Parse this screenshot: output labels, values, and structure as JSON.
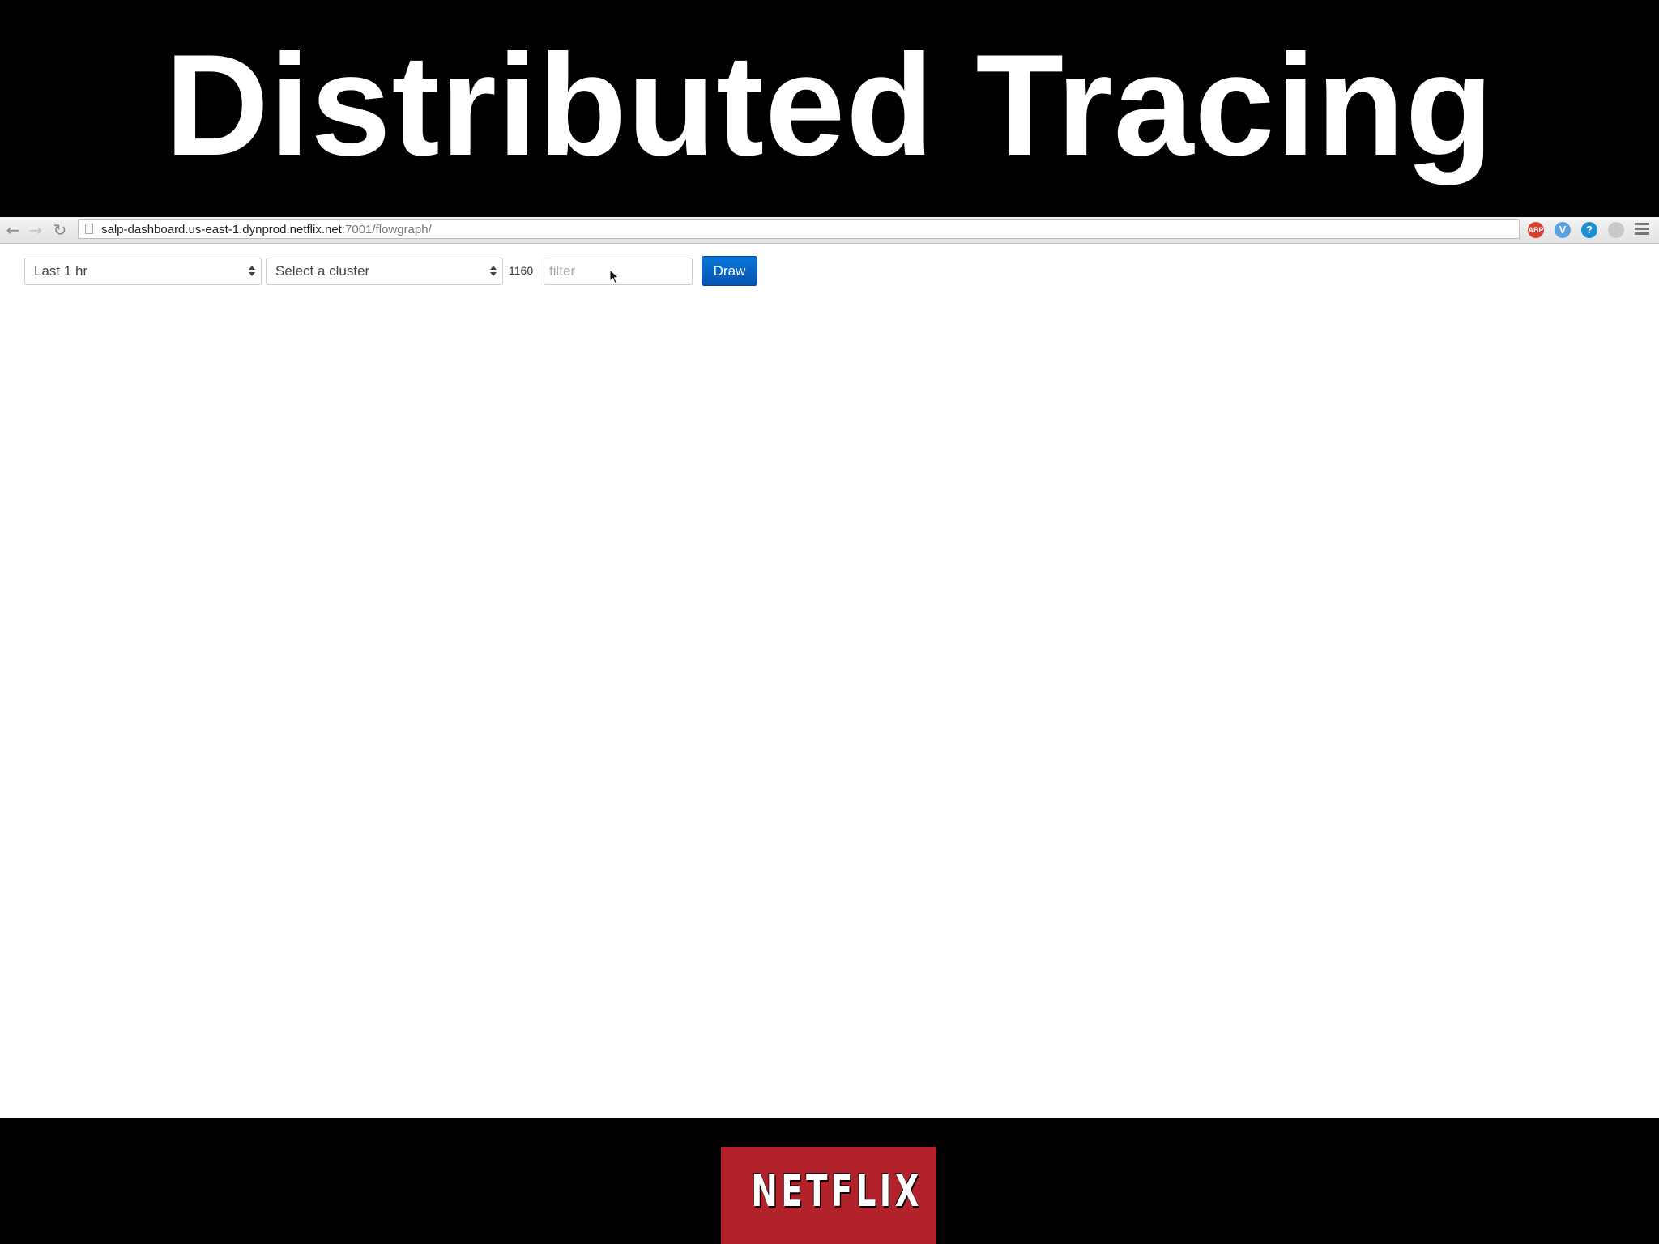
{
  "slide": {
    "title": "Distributed Tracing",
    "logo": "NETFLIX"
  },
  "browser": {
    "url_host": "salp-dashboard.us-east-1.dynprod.netflix.net",
    "url_path": ":7001/flowgraph/",
    "extensions": [
      {
        "icon": "adblock-icon",
        "label": "ABP",
        "color": "#d8412f"
      },
      {
        "icon": "extension-v-icon",
        "label": "V",
        "color": "#5aa2e0"
      },
      {
        "icon": "extension-1password-icon",
        "label": "?",
        "color": "#1e8fd0"
      },
      {
        "icon": "extension-sync-icon",
        "label": "",
        "color": "#c9c9c9"
      }
    ]
  },
  "toolbar": {
    "time_range": "Last 1 hr",
    "cluster": "Select a cluster",
    "count": "1160",
    "filter_placeholder": "filter",
    "draw_label": "Draw"
  },
  "colors": {
    "draw_button": "#0a63c6",
    "logo_background": "#b1222a"
  }
}
